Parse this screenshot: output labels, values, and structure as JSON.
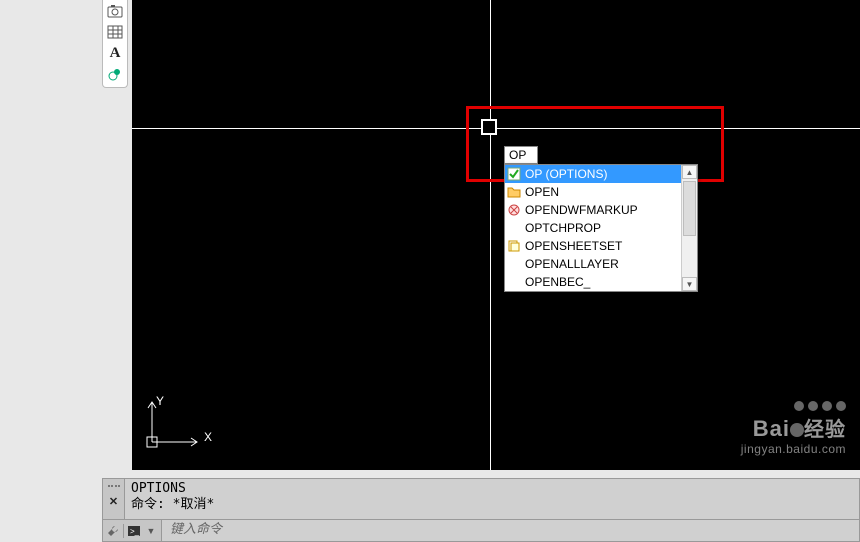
{
  "toolbox": {
    "items": [
      {
        "name": "Camera"
      },
      {
        "name": "Table"
      },
      {
        "name": "Text",
        "label": "A"
      },
      {
        "name": "Donut"
      }
    ]
  },
  "dyninput": {
    "value": "OP"
  },
  "autocomplete": {
    "items": [
      {
        "label": "OP (OPTIONS)",
        "icon": "check",
        "selected": true
      },
      {
        "label": "OPEN",
        "icon": "folder",
        "selected": false
      },
      {
        "label": "OPENDWFMARKUP",
        "icon": "markup",
        "selected": false
      },
      {
        "label": "OPTCHPROP",
        "icon": "",
        "selected": false
      },
      {
        "label": "OPENSHEETSET",
        "icon": "sheet",
        "selected": false
      },
      {
        "label": "OPENALLLAYER",
        "icon": "",
        "selected": false
      },
      {
        "label": "OPENBEC_",
        "icon": "",
        "selected": false
      }
    ]
  },
  "ucs": {
    "x": "X",
    "y": "Y"
  },
  "command": {
    "history": [
      "OPTIONS",
      "命令: *取消*"
    ],
    "prompt": "键入命令"
  },
  "watermark": {
    "line1a": "Bai",
    "line1b": "经验",
    "line2": "jingyan.baidu.com"
  }
}
